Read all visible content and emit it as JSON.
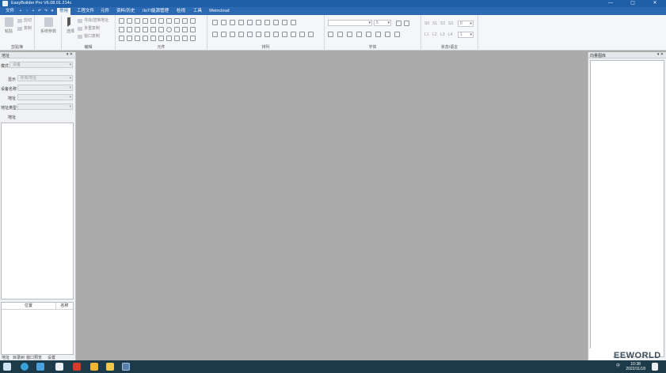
{
  "app": {
    "title": "EasyBuilder Pro V6.08.01.214c"
  },
  "window_controls": {
    "minimize": "—",
    "maximize": "▢",
    "close": "✕"
  },
  "menubar": {
    "items": [
      "文件",
      "常用",
      "工程文件",
      "元件",
      "资料/历史",
      "IIoT/能源管理",
      "检视",
      "工具",
      "Weincloud"
    ],
    "active": "常用"
  },
  "ribbon": {
    "clipboard": {
      "group_label": "剪贴簿",
      "paste": "粘贴",
      "cut": "剪切",
      "copy": "复制"
    },
    "system": {
      "label": "系统参数"
    },
    "edit": {
      "group_label": "编辑",
      "select": "选择",
      "find_replace": "寻找/替换地址",
      "multi_copy": "多重复制",
      "window_copy": "窗口复制"
    },
    "objects": {
      "group_label": "元件"
    },
    "arrange": {
      "group_label": "排列"
    },
    "font": {
      "group_label": "字体",
      "size_value": "5"
    },
    "state": {
      "group_label": "状态/语言",
      "s_labels": [
        "S0",
        "S1",
        "S2",
        "S3"
      ],
      "l_labels": [
        "L1",
        "L2",
        "L3",
        "L4"
      ],
      "s_value": "0",
      "l_value": "1"
    }
  },
  "left_panel": {
    "title": "地址",
    "rows": [
      {
        "label": "模式",
        "value": "设备"
      },
      {
        "label": "显示",
        "value": "所有地址"
      },
      {
        "label": "设备名称",
        "value": ""
      },
      {
        "label": "地址",
        "value": ""
      },
      {
        "label": "地址类型",
        "value": ""
      }
    ],
    "section_label": "地址",
    "table_headers": [
      "位置",
      "名称"
    ],
    "bottom_tabs": [
      "地址",
      "目录树",
      "窗口预览",
      "设置"
    ]
  },
  "right_panel": {
    "title": "向量图库"
  },
  "taskbar": {
    "time": "10:38",
    "date": "2022/11/18",
    "ime": "中"
  },
  "watermark": {
    "text": "EEWORLD"
  }
}
